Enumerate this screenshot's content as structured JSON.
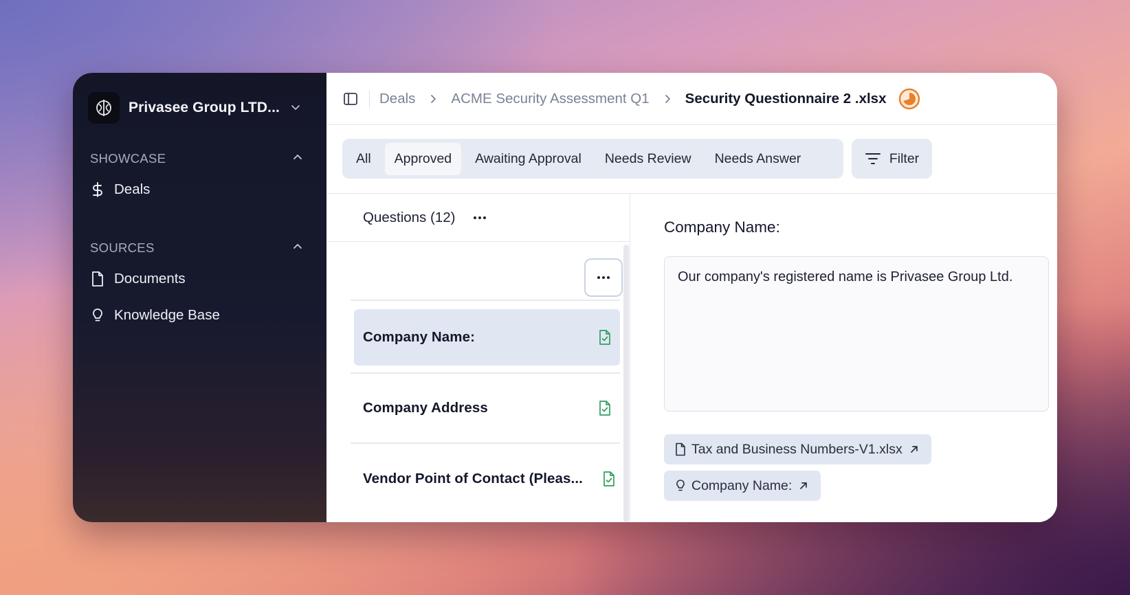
{
  "sidebar": {
    "org_name": "Privasee Group LTD...",
    "sections": [
      {
        "title": "SHOWCASE",
        "items": [
          {
            "label": "Deals",
            "icon": "dollar-icon"
          }
        ]
      },
      {
        "title": "SOURCES",
        "items": [
          {
            "label": "Documents",
            "icon": "document-icon"
          },
          {
            "label": "Knowledge Base",
            "icon": "lightbulb-icon"
          }
        ]
      }
    ]
  },
  "breadcrumb": {
    "items": [
      "Deals",
      "ACME Security Assessment Q1"
    ],
    "current": "Security Questionnaire 2 .xlsx"
  },
  "filters": {
    "tabs": [
      "All",
      "Approved",
      "Awaiting Approval",
      "Needs Review",
      "Needs Answer"
    ],
    "active_tab": "Approved",
    "filter_label": "Filter"
  },
  "questions": {
    "header": "Questions (12)",
    "items": [
      {
        "label": "Company Name:",
        "selected": true
      },
      {
        "label": "Company Address",
        "selected": false
      },
      {
        "label": "Vendor Point of Contact (Pleas...",
        "selected": false
      }
    ]
  },
  "answer": {
    "title": "Company Name:",
    "text": "Our company's registered name is Privasee Group Ltd.",
    "sources": [
      {
        "label": "Tax and Business Numbers-V1.xlsx",
        "icon": "document-icon"
      },
      {
        "label": "Company Name:",
        "icon": "lightbulb-icon"
      }
    ]
  },
  "colors": {
    "sidebar_bg": "#141628",
    "accent_orange": "#e8802a",
    "approved_green": "#2f9e62",
    "chip_bg": "#e1e7f2"
  }
}
